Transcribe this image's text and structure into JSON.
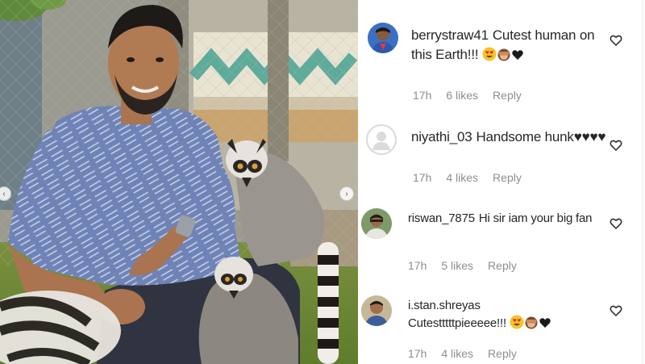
{
  "comments": [
    {
      "username": "berrystraw41",
      "text": "Cutest human on this Earth!!!",
      "emojis": [
        "heart-eyes-emoji",
        "see-no-evil-monkey-emoji",
        "black-heart-emoji"
      ],
      "time": "17h",
      "likes": "6 likes",
      "reply": "Reply",
      "avatar": "profile-photo"
    },
    {
      "username": "niyathi_03",
      "text": "Handsome hunk♥♥♥♥",
      "time": "17h",
      "likes": "4 likes",
      "reply": "Reply",
      "avatar": "default-avatar"
    },
    {
      "username": "riswan_7875",
      "text": "Hi sir iam your big fan",
      "time": "17h",
      "likes": "5 likes",
      "reply": "Reply",
      "avatar": "profile-photo"
    },
    {
      "username": "i.stan.shreyas",
      "text": "Cutestttttpieeeee!!!",
      "emojis": [
        "heart-eyes-emoji",
        "see-no-evil-monkey-emoji",
        "black-heart-emoji"
      ],
      "time": "17h",
      "likes": "4 likes",
      "reply": "Reply",
      "avatar": "profile-photo"
    }
  ],
  "photo": {
    "subject": "man in patterned blue shirt crouching beside ring-tailed lemurs",
    "carousel_prev_icon": "chevron-left-icon",
    "carousel_next_icon": "chevron-right-icon"
  },
  "colors": {
    "text": "#262626",
    "meta": "#8e8e8e",
    "heart_outline": "#262626"
  }
}
